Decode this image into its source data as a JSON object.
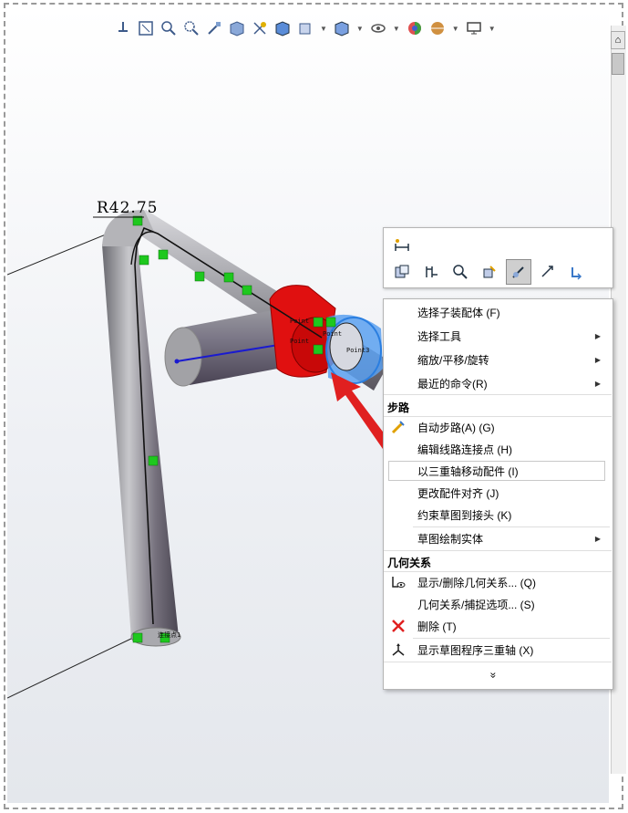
{
  "toolbar": {
    "icons": [
      "view-orientation-icon",
      "zoom-to-fit-icon",
      "zoom-area-icon",
      "zoom-selection-icon",
      "previous-view-icon",
      "section-view-icon",
      "dynamic-annotation-icon",
      "view-cube-icon",
      "display-style-icon",
      "hide-show-icon",
      "appearance-icon",
      "scene-icon",
      "monitor-icon"
    ]
  },
  "viewport": {
    "dimension_label": "R42.75"
  },
  "context_toolbar": {
    "icons": [
      "smart-dimension-icon",
      "component-properties-icon",
      "swap-icon",
      "zoom-selection-icon",
      "edit-component-icon",
      "move-with-triad-icon",
      "rotate-view-icon",
      "undo-icon"
    ]
  },
  "menu": {
    "items_top": [
      {
        "label": "选择子装配体 (F)",
        "arrow": ""
      },
      {
        "label": "选择工具",
        "arrow": "▶"
      },
      {
        "label": "缩放/平移/旋转",
        "arrow": "▶"
      },
      {
        "label": "最近的命令(R)",
        "arrow": "▶"
      }
    ],
    "section_routing": "步路",
    "items_routing": [
      {
        "label": "自动步路(A) (G)",
        "arrow": ""
      },
      {
        "label": "编辑线路连接点 (H)",
        "arrow": ""
      },
      {
        "label": "以三重轴移动配件 (I)",
        "arrow": ""
      },
      {
        "label": "更改配件对齐 (J)",
        "arrow": ""
      },
      {
        "label": "约束草图到接头 (K)",
        "arrow": ""
      },
      {
        "label": "草图绘制实体",
        "arrow": "▶"
      }
    ],
    "section_relations": "几何关系",
    "items_relations": [
      {
        "label": "显示/删除几何关系... (Q)",
        "arrow": ""
      },
      {
        "label": "几何关系/捕捉选项... (S)",
        "arrow": ""
      },
      {
        "label": "删除 (T)",
        "arrow": ""
      },
      {
        "label": "显示草图程序三重轴 (X)",
        "arrow": ""
      }
    ],
    "more": "»"
  },
  "colors": {
    "pipe": "#8c8c92",
    "fitting_red": "#e01010",
    "highlight_blue": "#3a8ee8",
    "sketch_green": "#1ec81e",
    "arrow_red": "#e02020"
  }
}
